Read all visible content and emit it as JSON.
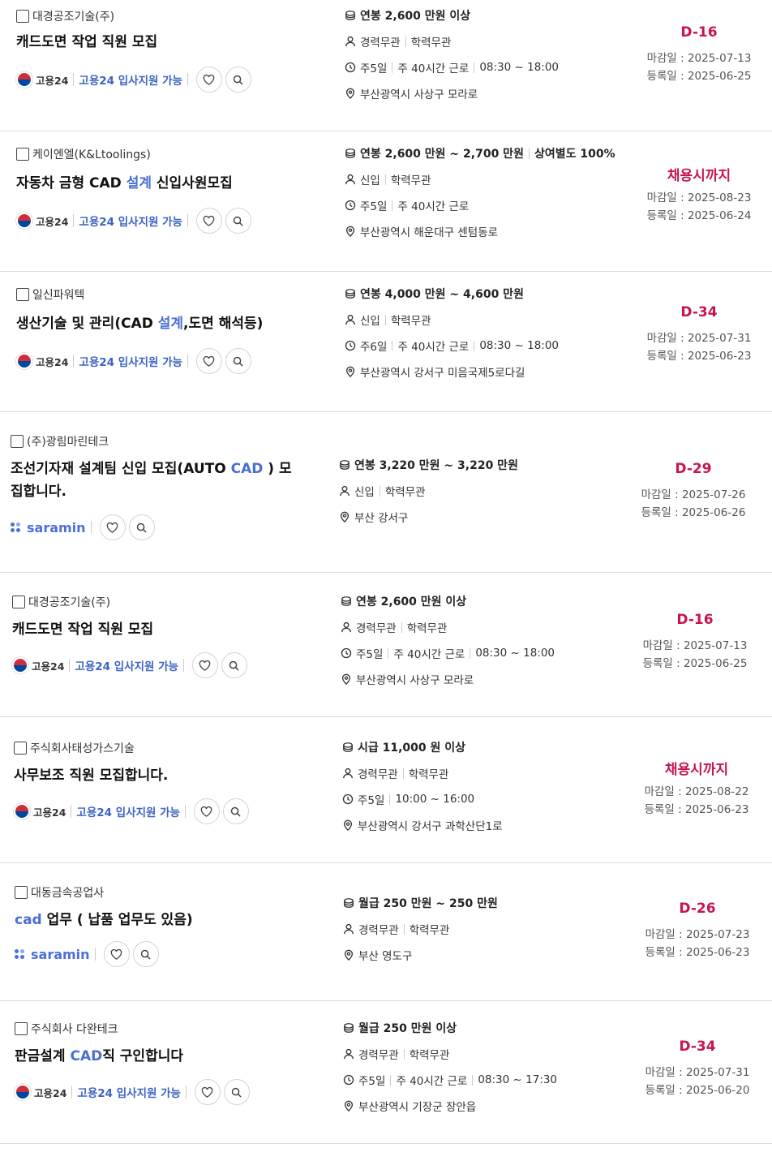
{
  "jobs": [
    {
      "company": "대경공조기술(주)",
      "title_parts": [
        {
          "t": "캐드도면 작업 직원 모집",
          "hl": false
        }
      ],
      "source": "고용24",
      "apply": "고용24 입사지원 가능",
      "salary": [
        "연봉 2,600 만원 이상"
      ],
      "career": [
        "경력무관",
        "학력무관"
      ],
      "hours": [
        "주5일",
        "주 40시간 근로",
        "08:30 ~ 18:00"
      ],
      "location": "부산광역시 사상구 모라로",
      "dday": "D-16",
      "deadline": "마감일 : 2025-07-13",
      "registered": "등록일 : 2025-06-25"
    },
    {
      "company": "케이엔엘(K&Ltoolings)",
      "title_parts": [
        {
          "t": "자동차 금형 CAD ",
          "hl": false
        },
        {
          "t": "설계",
          "hl": true
        },
        {
          "t": " 신입사원모집",
          "hl": false
        }
      ],
      "source": "고용24",
      "apply": "고용24 입사지원 가능",
      "salary": [
        "연봉 2,600 만원 ~ 2,700 만원",
        "상여별도 100%"
      ],
      "career": [
        "신입",
        "학력무관"
      ],
      "hours": [
        "주5일",
        "주 40시간 근로"
      ],
      "location": "부산광역시 해운대구 센텀동로",
      "dday": "채용시까지",
      "deadline": "마감일 : 2025-08-23",
      "registered": "등록일 : 2025-06-24"
    },
    {
      "company": "일신파워텍",
      "title_parts": [
        {
          "t": "생산기술 및 관리(CAD ",
          "hl": false
        },
        {
          "t": "설계",
          "hl": true
        },
        {
          "t": ",도면 해석등)",
          "hl": false
        }
      ],
      "source": "고용24",
      "apply": "고용24 입사지원 가능",
      "salary": [
        "연봉 4,000 만원 ~ 4,600 만원"
      ],
      "career": [
        "신입",
        "학력무관"
      ],
      "hours": [
        "주6일",
        "주 40시간 근로",
        "08:30 ~ 18:00"
      ],
      "location": "부산광역시 강서구 미음국제5로다길",
      "dday": "D-34",
      "deadline": "마감일 : 2025-07-31",
      "registered": "등록일 : 2025-06-23"
    },
    {
      "company": "(주)광림마린테크",
      "title_parts": [
        {
          "t": "조선기자재 설계팀 신입 모집(AUTO ",
          "hl": false
        },
        {
          "t": "CAD",
          "hl": true
        },
        {
          "t": " ) 모집합니다.",
          "hl": false
        }
      ],
      "source": "saramin",
      "apply": "",
      "salary": [
        "연봉 3,220 만원 ~ 3,220 만원"
      ],
      "career": [
        "신입",
        "학력무관"
      ],
      "hours": [],
      "location": "부산 강서구",
      "dday": "D-29",
      "deadline": "마감일 : 2025-07-26",
      "registered": "등록일 : 2025-06-26"
    },
    {
      "company": "대경공조기술(주)",
      "title_parts": [
        {
          "t": "캐드도면 작업 직원 모집",
          "hl": false
        }
      ],
      "source": "고용24",
      "apply": "고용24 입사지원 가능",
      "salary": [
        "연봉 2,600 만원 이상"
      ],
      "career": [
        "경력무관",
        "학력무관"
      ],
      "hours": [
        "주5일",
        "주 40시간 근로",
        "08:30 ~ 18:00"
      ],
      "location": "부산광역시 사상구 모라로",
      "dday": "D-16",
      "deadline": "마감일 : 2025-07-13",
      "registered": "등록일 : 2025-06-25"
    },
    {
      "company": "주식회사태성가스기술",
      "title_parts": [
        {
          "t": "사무보조 직원 모집합니다.",
          "hl": false
        }
      ],
      "source": "고용24",
      "apply": "고용24 입사지원 가능",
      "salary": [
        "시급 11,000 원 이상"
      ],
      "career": [
        "경력무관",
        "학력무관"
      ],
      "hours": [
        "주5일",
        "10:00 ~ 16:00"
      ],
      "location": "부산광역시 강서구 과학산단1로",
      "dday": "채용시까지",
      "deadline": "마감일 : 2025-08-22",
      "registered": "등록일 : 2025-06-23"
    },
    {
      "company": "대동금속공업사",
      "title_parts": [
        {
          "t": "cad",
          "hl": true
        },
        {
          "t": " 업무 ( 납품 업무도 있음)",
          "hl": false
        }
      ],
      "source": "saramin",
      "apply": "",
      "salary": [
        "월급 250 만원 ~ 250 만원"
      ],
      "career": [
        "경력무관",
        "학력무관"
      ],
      "hours": [],
      "location": "부산 영도구",
      "dday": "D-26",
      "deadline": "마감일 : 2025-07-23",
      "registered": "등록일 : 2025-06-23"
    },
    {
      "company": "주식회사 다완테크",
      "title_parts": [
        {
          "t": "판금설계 ",
          "hl": false
        },
        {
          "t": "CAD",
          "hl": true
        },
        {
          "t": "직 구인합니다",
          "hl": false
        }
      ],
      "source": "고용24",
      "apply": "고용24 입사지원 가능",
      "salary": [
        "월급 250 만원 이상"
      ],
      "career": [
        "경력무관",
        "학력무관"
      ],
      "hours": [
        "주5일",
        "주 40시간 근로",
        "08:30 ~ 17:30"
      ],
      "location": "부산광역시 기장군 장안읍",
      "dday": "D-34",
      "deadline": "마감일 : 2025-07-31",
      "registered": "등록일 : 2025-06-20"
    }
  ],
  "colors": {
    "dday": "#c8144e",
    "highlight": "#4a6fd4",
    "apply": "#3f63c4",
    "saramin": "#4e6fdc"
  },
  "icons": {
    "salary": "coin-icon",
    "career": "person-icon",
    "hours": "clock-icon",
    "location": "map-pin-icon",
    "like": "heart-icon",
    "search": "magnifier-icon"
  }
}
